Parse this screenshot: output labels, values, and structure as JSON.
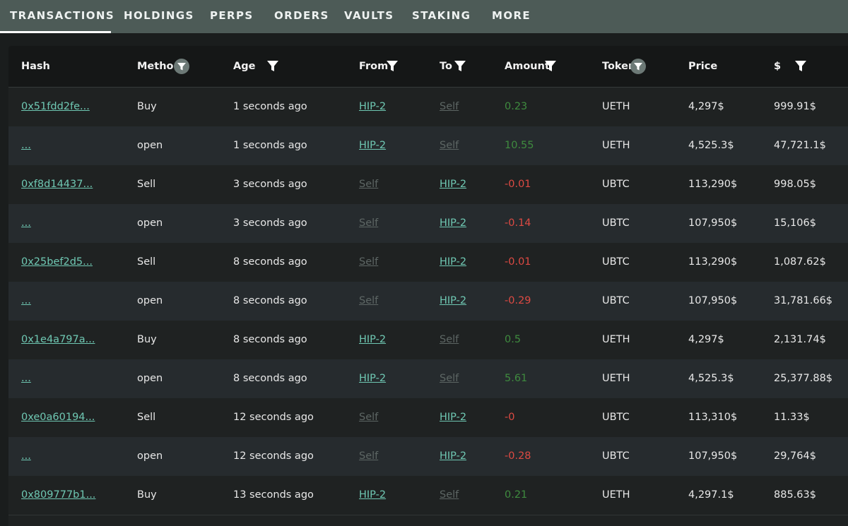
{
  "tabs": [
    {
      "label": "TRANSACTIONS",
      "active": true
    },
    {
      "label": "HOLDINGS"
    },
    {
      "label": "PERPS"
    },
    {
      "label": "ORDERS"
    },
    {
      "label": "VAULTS"
    },
    {
      "label": "STAKING"
    },
    {
      "label": "MORE"
    }
  ],
  "columns": {
    "hash": "Hash",
    "method": "Method",
    "age": "Age",
    "from": "From",
    "to": "To",
    "amount": "Amount",
    "token": "Token",
    "price": "Price",
    "usd": "$"
  },
  "colors": {
    "tabbar": "#4d5b57",
    "link": "#6fc8b3",
    "muted_link": "#5d6664",
    "positive": "#3f8b3f",
    "negative": "#dd4a43"
  },
  "rows": [
    {
      "hash": "0x51fdd2fe...",
      "method": "Buy",
      "age": "1 seconds ago",
      "from": "HIP-2",
      "to": "Self",
      "amount": "0.23",
      "token": "UETH",
      "price": "4,297$",
      "usd": "999.91$"
    },
    {
      "hash": "...",
      "method": "open",
      "age": "1 seconds ago",
      "from": "HIP-2",
      "to": "Self",
      "amount": "10.55",
      "token": "UETH",
      "price": "4,525.3$",
      "usd": "47,721.1$"
    },
    {
      "hash": "0xf8d14437...",
      "method": "Sell",
      "age": "3 seconds ago",
      "from": "Self",
      "to": "HIP-2",
      "amount": "-0.01",
      "token": "UBTC",
      "price": "113,290$",
      "usd": "998.05$"
    },
    {
      "hash": "...",
      "method": "open",
      "age": "3 seconds ago",
      "from": "Self",
      "to": "HIP-2",
      "amount": "-0.14",
      "token": "UBTC",
      "price": "107,950$",
      "usd": "15,106$"
    },
    {
      "hash": "0x25bef2d5...",
      "method": "Sell",
      "age": "8 seconds ago",
      "from": "Self",
      "to": "HIP-2",
      "amount": "-0.01",
      "token": "UBTC",
      "price": "113,290$",
      "usd": "1,087.62$"
    },
    {
      "hash": "...",
      "method": "open",
      "age": "8 seconds ago",
      "from": "Self",
      "to": "HIP-2",
      "amount": "-0.29",
      "token": "UBTC",
      "price": "107,950$",
      "usd": "31,781.66$"
    },
    {
      "hash": "0x1e4a797a...",
      "method": "Buy",
      "age": "8 seconds ago",
      "from": "HIP-2",
      "to": "Self",
      "amount": "0.5",
      "token": "UETH",
      "price": "4,297$",
      "usd": "2,131.74$"
    },
    {
      "hash": "...",
      "method": "open",
      "age": "8 seconds ago",
      "from": "HIP-2",
      "to": "Self",
      "amount": "5.61",
      "token": "UETH",
      "price": "4,525.3$",
      "usd": "25,377.88$"
    },
    {
      "hash": "0xe0a60194...",
      "method": "Sell",
      "age": "12 seconds ago",
      "from": "Self",
      "to": "HIP-2",
      "amount": "-0",
      "token": "UBTC",
      "price": "113,310$",
      "usd": "11.33$"
    },
    {
      "hash": "...",
      "method": "open",
      "age": "12 seconds ago",
      "from": "Self",
      "to": "HIP-2",
      "amount": "-0.28",
      "token": "UBTC",
      "price": "107,950$",
      "usd": "29,764$"
    },
    {
      "hash": "0x809777b1...",
      "method": "Buy",
      "age": "13 seconds ago",
      "from": "HIP-2",
      "to": "Self",
      "amount": "0.21",
      "token": "UETH",
      "price": "4,297.1$",
      "usd": "885.63$"
    }
  ]
}
